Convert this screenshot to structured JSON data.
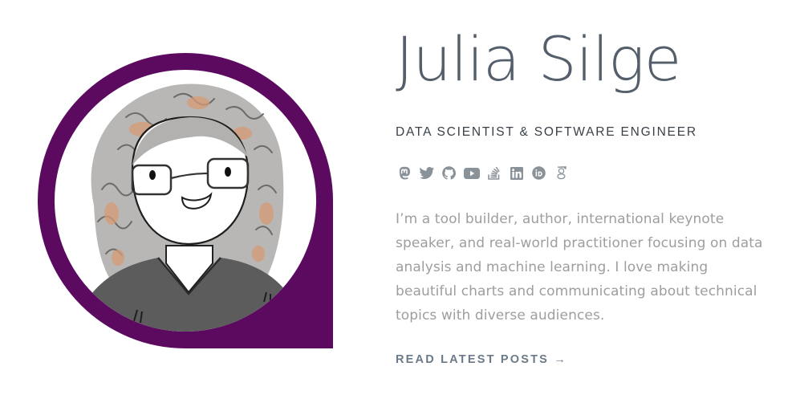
{
  "profile": {
    "name": "Julia Silge",
    "role": "DATA SCIENTIST & SOFTWARE ENGINEER",
    "bio": "I’m a tool builder, author, international keynote speaker, and real-world practitioner focusing on data analysis and machine learning. I love making beautiful charts and communicating about technical topics with diverse audiences.",
    "cta_label": "READ LATEST POSTS →"
  },
  "social_icons": [
    "mastodon-icon",
    "twitter-icon",
    "github-icon",
    "youtube-icon",
    "stack-overflow-icon",
    "linkedin-icon",
    "orcid-icon",
    "google-scholar-icon"
  ],
  "colors": {
    "avatar_frame": "#5b0a60",
    "name": "#545f6b",
    "icon": "#8a9299",
    "bio_text": "#9c9ea0",
    "cta": "#6b7a88"
  }
}
